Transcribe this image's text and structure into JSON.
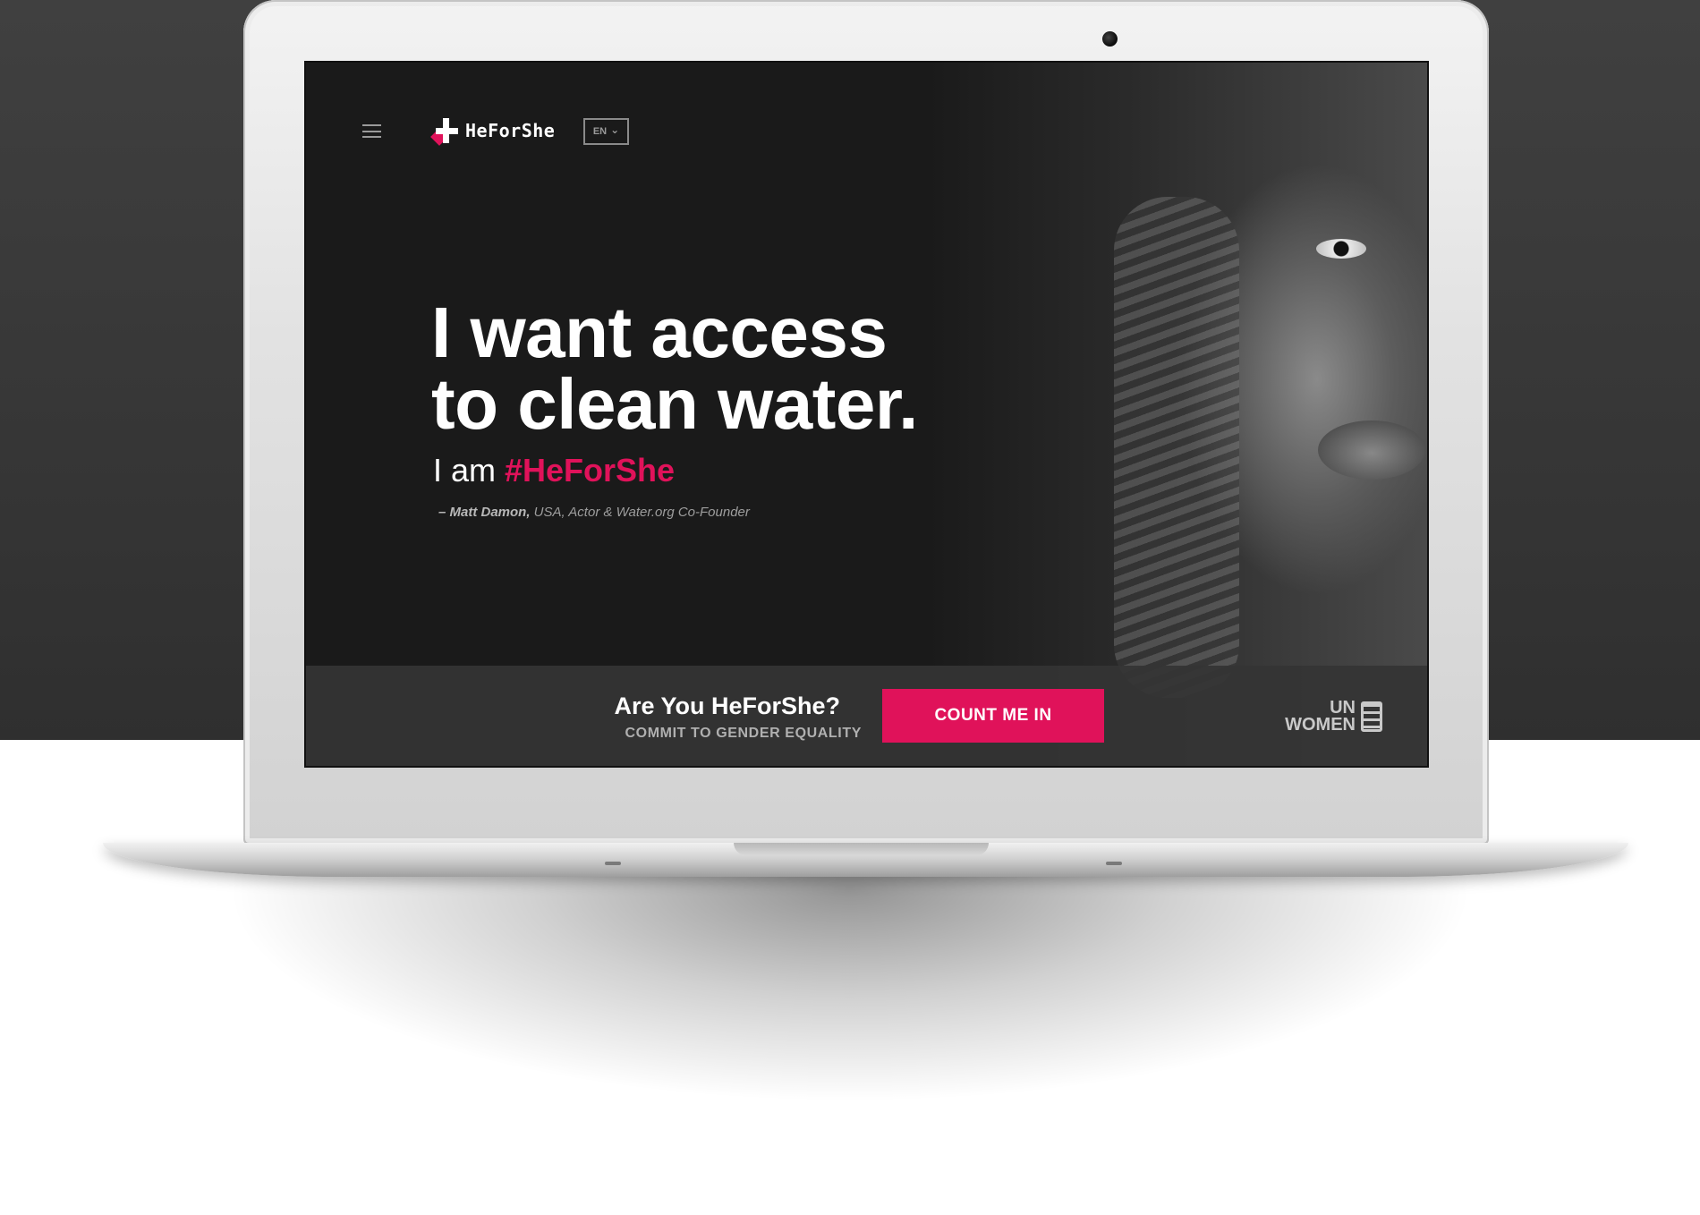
{
  "brand": {
    "name": "HeForShe",
    "accent": "#e0125a"
  },
  "nav": {
    "language": "EN",
    "language_chevron": "⌄"
  },
  "hero": {
    "headline_line1": "I want access",
    "headline_line2": "to clean water.",
    "sub_prefix": "I am ",
    "sub_tag": "#HeForShe",
    "attribution_name": "– Matt Damon,",
    "attribution_detail": " USA, Actor & Water.org Co-Founder"
  },
  "cta": {
    "question": "Are You HeForShe?",
    "subtitle": "COMMIT TO GENDER EQUALITY",
    "button": "COUNT ME IN"
  },
  "partner": {
    "line1": "UN",
    "line2": "WOMEN"
  },
  "icons": [
    "hamburger-menu-icon",
    "heforshe-logo-icon",
    "chevron-down-icon",
    "un-women-logo-icon"
  ]
}
